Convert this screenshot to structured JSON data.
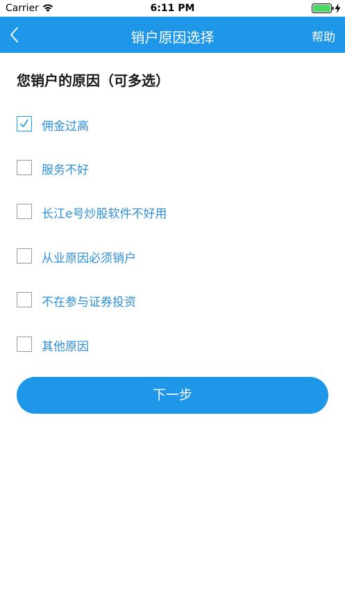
{
  "status_bar": {
    "carrier": "Carrier",
    "time": "6:11 PM"
  },
  "nav": {
    "title": "销户原因选择",
    "help": "帮助",
    "color": "#1e97e8"
  },
  "section": {
    "title": "您销户的原因（可多选）"
  },
  "options": [
    {
      "label": "佣金过高",
      "checked": true
    },
    {
      "label": "服务不好",
      "checked": false
    },
    {
      "label": "长江e号炒股软件不好用",
      "checked": false
    },
    {
      "label": "从业原因必须销户",
      "checked": false
    },
    {
      "label": "不在参与证券投资",
      "checked": false
    },
    {
      "label": "其他原因",
      "checked": false
    }
  ],
  "next_button": {
    "label": "下一步"
  }
}
